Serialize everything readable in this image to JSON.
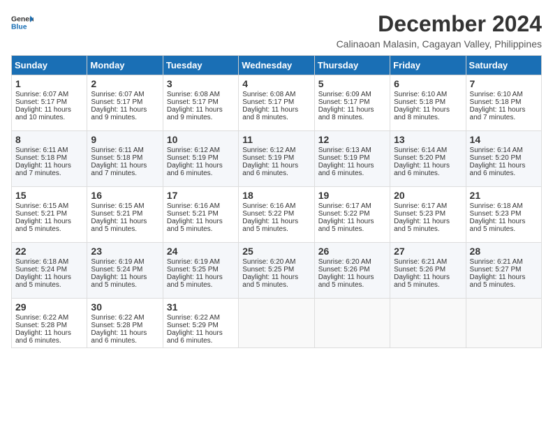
{
  "logo": {
    "line1": "General",
    "line2": "Blue"
  },
  "title": "December 2024",
  "subtitle": "Calinaoan Malasin, Cagayan Valley, Philippines",
  "weekdays": [
    "Sunday",
    "Monday",
    "Tuesday",
    "Wednesday",
    "Thursday",
    "Friday",
    "Saturday"
  ],
  "weeks": [
    [
      {
        "day": "1",
        "lines": [
          "Sunrise: 6:07 AM",
          "Sunset: 5:17 PM",
          "Daylight: 11 hours",
          "and 10 minutes."
        ]
      },
      {
        "day": "2",
        "lines": [
          "Sunrise: 6:07 AM",
          "Sunset: 5:17 PM",
          "Daylight: 11 hours",
          "and 9 minutes."
        ]
      },
      {
        "day": "3",
        "lines": [
          "Sunrise: 6:08 AM",
          "Sunset: 5:17 PM",
          "Daylight: 11 hours",
          "and 9 minutes."
        ]
      },
      {
        "day": "4",
        "lines": [
          "Sunrise: 6:08 AM",
          "Sunset: 5:17 PM",
          "Daylight: 11 hours",
          "and 8 minutes."
        ]
      },
      {
        "day": "5",
        "lines": [
          "Sunrise: 6:09 AM",
          "Sunset: 5:17 PM",
          "Daylight: 11 hours",
          "and 8 minutes."
        ]
      },
      {
        "day": "6",
        "lines": [
          "Sunrise: 6:10 AM",
          "Sunset: 5:18 PM",
          "Daylight: 11 hours",
          "and 8 minutes."
        ]
      },
      {
        "day": "7",
        "lines": [
          "Sunrise: 6:10 AM",
          "Sunset: 5:18 PM",
          "Daylight: 11 hours",
          "and 7 minutes."
        ]
      }
    ],
    [
      {
        "day": "8",
        "lines": [
          "Sunrise: 6:11 AM",
          "Sunset: 5:18 PM",
          "Daylight: 11 hours",
          "and 7 minutes."
        ]
      },
      {
        "day": "9",
        "lines": [
          "Sunrise: 6:11 AM",
          "Sunset: 5:18 PM",
          "Daylight: 11 hours",
          "and 7 minutes."
        ]
      },
      {
        "day": "10",
        "lines": [
          "Sunrise: 6:12 AM",
          "Sunset: 5:19 PM",
          "Daylight: 11 hours",
          "and 6 minutes."
        ]
      },
      {
        "day": "11",
        "lines": [
          "Sunrise: 6:12 AM",
          "Sunset: 5:19 PM",
          "Daylight: 11 hours",
          "and 6 minutes."
        ]
      },
      {
        "day": "12",
        "lines": [
          "Sunrise: 6:13 AM",
          "Sunset: 5:19 PM",
          "Daylight: 11 hours",
          "and 6 minutes."
        ]
      },
      {
        "day": "13",
        "lines": [
          "Sunrise: 6:14 AM",
          "Sunset: 5:20 PM",
          "Daylight: 11 hours",
          "and 6 minutes."
        ]
      },
      {
        "day": "14",
        "lines": [
          "Sunrise: 6:14 AM",
          "Sunset: 5:20 PM",
          "Daylight: 11 hours",
          "and 6 minutes."
        ]
      }
    ],
    [
      {
        "day": "15",
        "lines": [
          "Sunrise: 6:15 AM",
          "Sunset: 5:21 PM",
          "Daylight: 11 hours",
          "and 5 minutes."
        ]
      },
      {
        "day": "16",
        "lines": [
          "Sunrise: 6:15 AM",
          "Sunset: 5:21 PM",
          "Daylight: 11 hours",
          "and 5 minutes."
        ]
      },
      {
        "day": "17",
        "lines": [
          "Sunrise: 6:16 AM",
          "Sunset: 5:21 PM",
          "Daylight: 11 hours",
          "and 5 minutes."
        ]
      },
      {
        "day": "18",
        "lines": [
          "Sunrise: 6:16 AM",
          "Sunset: 5:22 PM",
          "Daylight: 11 hours",
          "and 5 minutes."
        ]
      },
      {
        "day": "19",
        "lines": [
          "Sunrise: 6:17 AM",
          "Sunset: 5:22 PM",
          "Daylight: 11 hours",
          "and 5 minutes."
        ]
      },
      {
        "day": "20",
        "lines": [
          "Sunrise: 6:17 AM",
          "Sunset: 5:23 PM",
          "Daylight: 11 hours",
          "and 5 minutes."
        ]
      },
      {
        "day": "21",
        "lines": [
          "Sunrise: 6:18 AM",
          "Sunset: 5:23 PM",
          "Daylight: 11 hours",
          "and 5 minutes."
        ]
      }
    ],
    [
      {
        "day": "22",
        "lines": [
          "Sunrise: 6:18 AM",
          "Sunset: 5:24 PM",
          "Daylight: 11 hours",
          "and 5 minutes."
        ]
      },
      {
        "day": "23",
        "lines": [
          "Sunrise: 6:19 AM",
          "Sunset: 5:24 PM",
          "Daylight: 11 hours",
          "and 5 minutes."
        ]
      },
      {
        "day": "24",
        "lines": [
          "Sunrise: 6:19 AM",
          "Sunset: 5:25 PM",
          "Daylight: 11 hours",
          "and 5 minutes."
        ]
      },
      {
        "day": "25",
        "lines": [
          "Sunrise: 6:20 AM",
          "Sunset: 5:25 PM",
          "Daylight: 11 hours",
          "and 5 minutes."
        ]
      },
      {
        "day": "26",
        "lines": [
          "Sunrise: 6:20 AM",
          "Sunset: 5:26 PM",
          "Daylight: 11 hours",
          "and 5 minutes."
        ]
      },
      {
        "day": "27",
        "lines": [
          "Sunrise: 6:21 AM",
          "Sunset: 5:26 PM",
          "Daylight: 11 hours",
          "and 5 minutes."
        ]
      },
      {
        "day": "28",
        "lines": [
          "Sunrise: 6:21 AM",
          "Sunset: 5:27 PM",
          "Daylight: 11 hours",
          "and 5 minutes."
        ]
      }
    ],
    [
      {
        "day": "29",
        "lines": [
          "Sunrise: 6:22 AM",
          "Sunset: 5:28 PM",
          "Daylight: 11 hours",
          "and 6 minutes."
        ]
      },
      {
        "day": "30",
        "lines": [
          "Sunrise: 6:22 AM",
          "Sunset: 5:28 PM",
          "Daylight: 11 hours",
          "and 6 minutes."
        ]
      },
      {
        "day": "31",
        "lines": [
          "Sunrise: 6:22 AM",
          "Sunset: 5:29 PM",
          "Daylight: 11 hours",
          "and 6 minutes."
        ]
      },
      {
        "day": "",
        "lines": []
      },
      {
        "day": "",
        "lines": []
      },
      {
        "day": "",
        "lines": []
      },
      {
        "day": "",
        "lines": []
      }
    ]
  ]
}
